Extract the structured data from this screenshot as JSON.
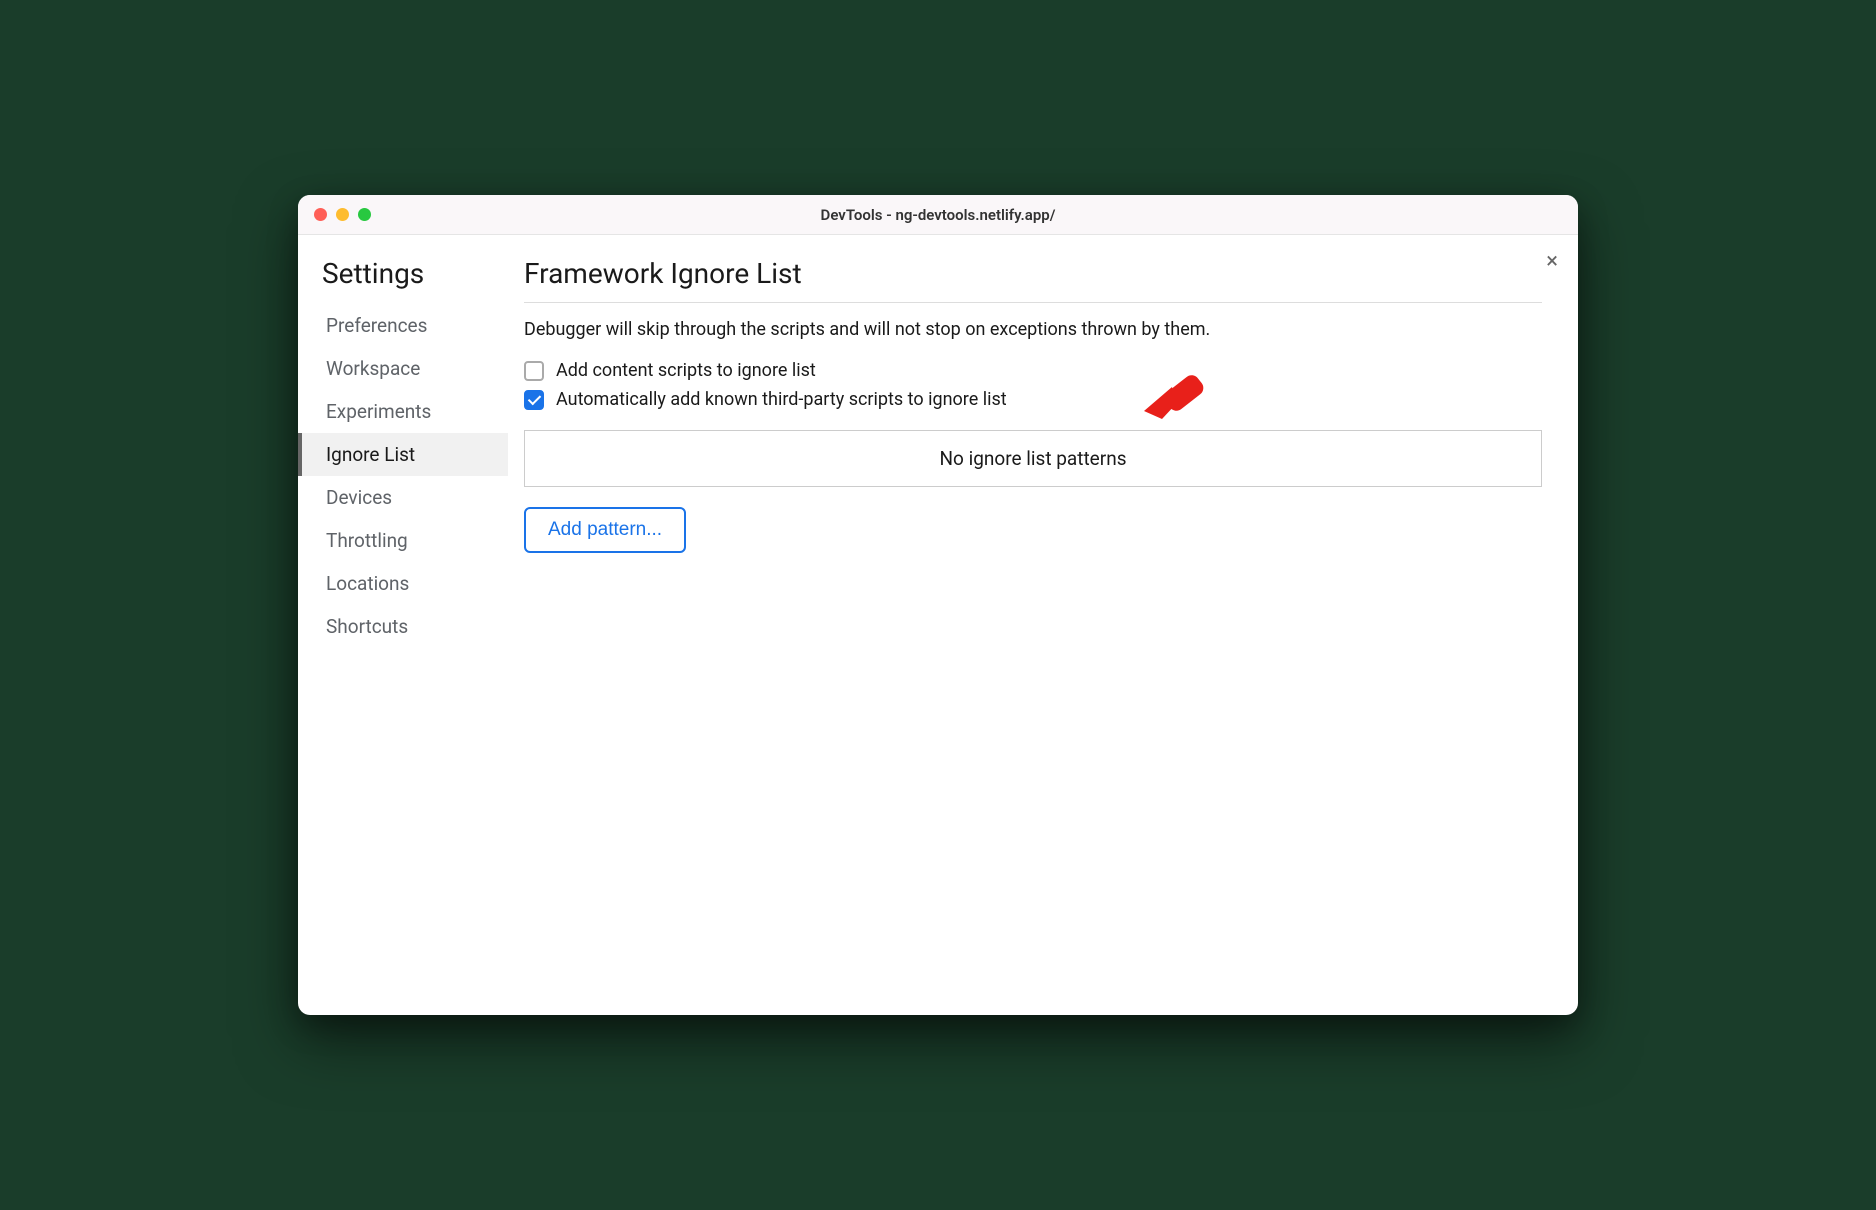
{
  "titlebar": {
    "title": "DevTools - ng-devtools.netlify.app/"
  },
  "close_label": "×",
  "sidebar": {
    "title": "Settings",
    "items": [
      {
        "label": "Preferences",
        "active": false
      },
      {
        "label": "Workspace",
        "active": false
      },
      {
        "label": "Experiments",
        "active": false
      },
      {
        "label": "Ignore List",
        "active": true
      },
      {
        "label": "Devices",
        "active": false
      },
      {
        "label": "Throttling",
        "active": false
      },
      {
        "label": "Locations",
        "active": false
      },
      {
        "label": "Shortcuts",
        "active": false
      }
    ]
  },
  "main": {
    "title": "Framework Ignore List",
    "description": "Debugger will skip through the scripts and will not stop on exceptions thrown by them.",
    "checkboxes": [
      {
        "label": "Add content scripts to ignore list",
        "checked": false
      },
      {
        "label": "Automatically add known third-party scripts to ignore list",
        "checked": true
      }
    ],
    "patterns_empty": "No ignore list patterns",
    "add_pattern_label": "Add pattern..."
  }
}
